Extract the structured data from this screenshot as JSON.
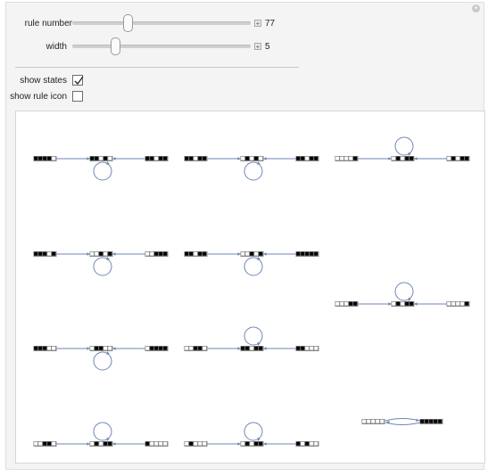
{
  "controls": {
    "rule_number": {
      "label": "rule number",
      "value": "77",
      "slider_fraction": 0.31
    },
    "width": {
      "label": "width",
      "value": "5",
      "slider_fraction": 0.24
    },
    "show_states": {
      "label": "show states",
      "checked": true
    },
    "show_rule_icon": {
      "label": "show rule icon",
      "checked": false
    }
  },
  "graph": {
    "edge_color": "#6f86b5",
    "cell_on": "#000000",
    "cell_off": "#ffffff",
    "components": [
      {
        "col": 0,
        "row": 0,
        "type": "chain-loop-below",
        "left": "11110",
        "mid": "11010",
        "right": "11011"
      },
      {
        "col": 1,
        "row": 0,
        "type": "chain-loop-below",
        "left": "11011",
        "mid": "01010",
        "right": "11011"
      },
      {
        "col": 2,
        "row": 0,
        "type": "chain-loop-above",
        "left": "00001",
        "mid": "01011",
        "right": "01011"
      },
      {
        "col": 0,
        "row": 1,
        "type": "chain-loop-below",
        "left": "11101",
        "mid": "00101",
        "right": "00111"
      },
      {
        "col": 1,
        "row": 1,
        "type": "chain-loop-below",
        "left": "11011",
        "mid": "00101",
        "right": "11111"
      },
      {
        "col": 2,
        "row": 1,
        "type": "chain-loop-above",
        "left": "00011",
        "mid": "01011",
        "right": "00001"
      },
      {
        "col": 0,
        "row": 2,
        "type": "chain-loop-below",
        "left": "11100",
        "mid": "01100",
        "right": "01111"
      },
      {
        "col": 1,
        "row": 2,
        "type": "chain-loop-above",
        "left": "00110",
        "mid": "11011",
        "right": "11000"
      },
      {
        "col": 2,
        "row": 2,
        "type": "two-cycle",
        "left": "00000",
        "right": "11111"
      },
      {
        "col": 0,
        "row": 3,
        "type": "chain-loop-above",
        "left": "00110",
        "mid": "01011",
        "right": "10000"
      },
      {
        "col": 1,
        "row": 3,
        "type": "chain-loop-above",
        "left": "01000",
        "mid": "01011",
        "right": "10100"
      }
    ]
  }
}
